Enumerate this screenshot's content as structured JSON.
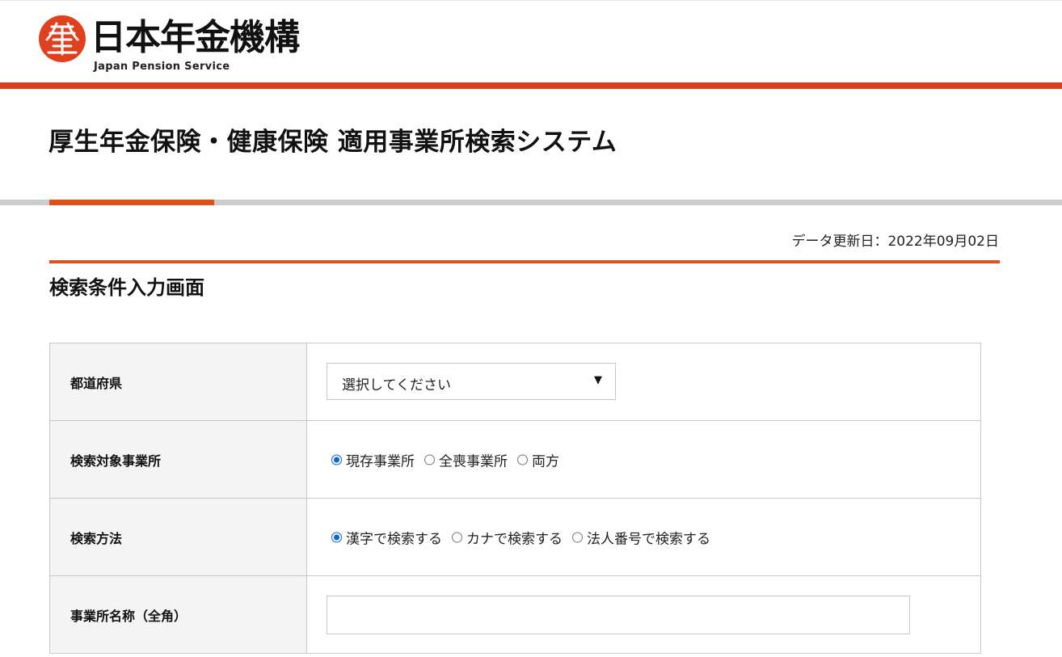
{
  "header": {
    "org_name": "日本年金機構",
    "org_name_en": "Japan Pension Service",
    "brand_color": "#d6401f",
    "logo_icon": "pension-logo-icon"
  },
  "system_title": "厚生年金保険・健康保険 適用事業所検索システム",
  "update_date": "データ更新日：2022年09月02日",
  "section_title": "検索条件入力画面",
  "form": {
    "prefecture": {
      "label": "都道府県",
      "selected": "選択してください"
    },
    "target": {
      "label": "検索対象事業所",
      "options": [
        "現存事業所",
        "全喪事業所",
        "両方"
      ],
      "selected_index": 0
    },
    "method": {
      "label": "検索方法",
      "options": [
        "漢字で検索する",
        "カナで検索する",
        "法人番号で検索する"
      ],
      "selected_index": 0
    },
    "office_name": {
      "label": "事業所名称（全角）",
      "value": ""
    }
  }
}
